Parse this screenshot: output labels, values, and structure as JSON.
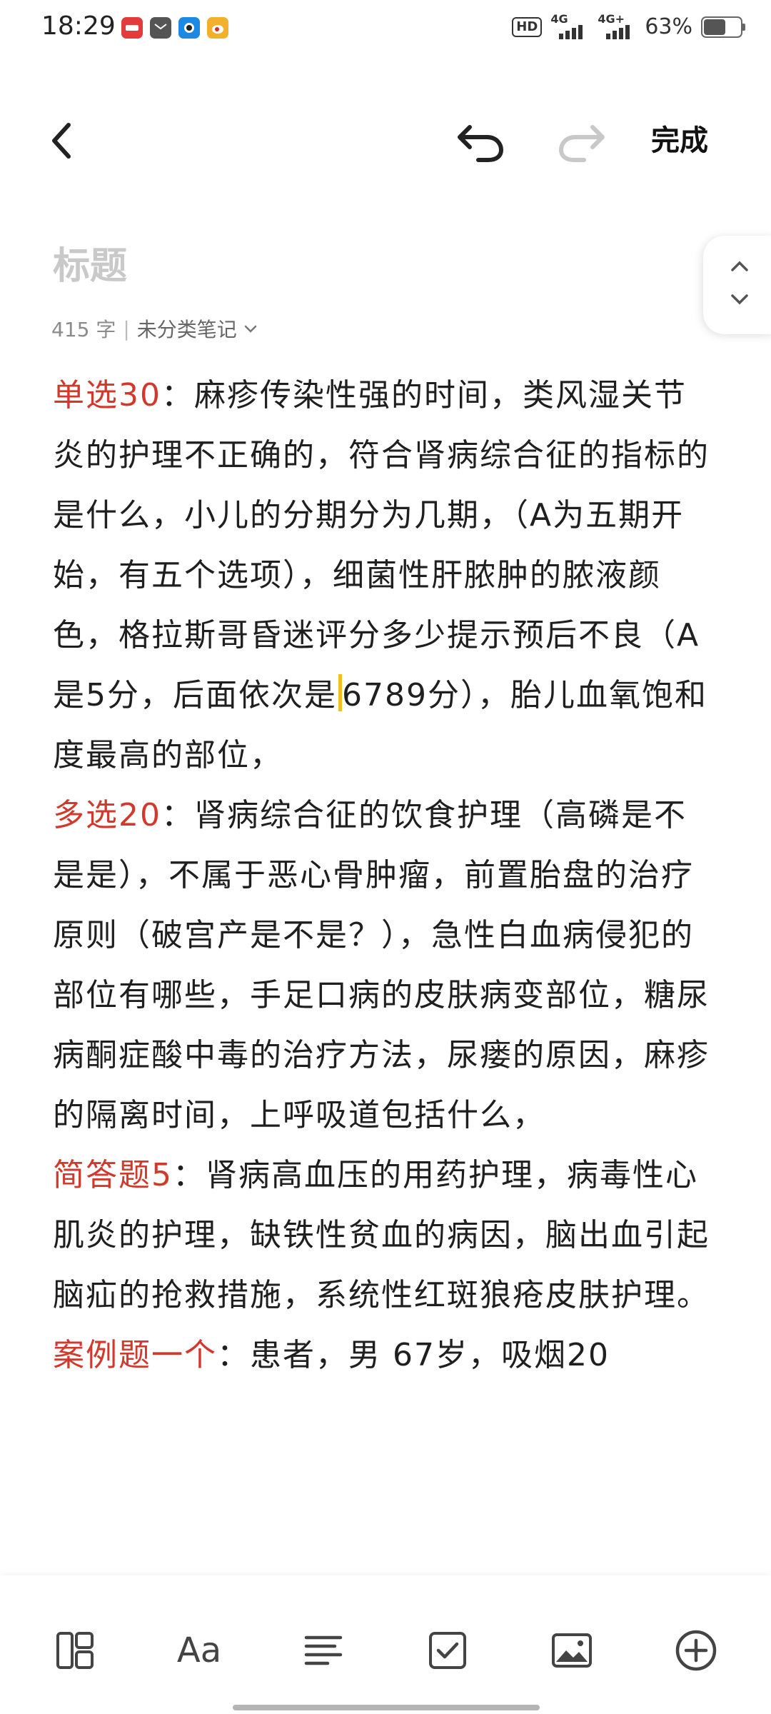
{
  "status_bar": {
    "time": "18:29",
    "hd_badge": "HD",
    "signal1_label": "4G",
    "signal2_label": "4G+",
    "battery_text": "63%",
    "battery_level": 0.63
  },
  "toolbar": {
    "done_label": "完成"
  },
  "note": {
    "title_placeholder": "标题",
    "word_count": "415 字",
    "separator": "|",
    "category": "未分类笔记"
  },
  "paragraphs": [
    {
      "label": "单选30",
      "body": "：麻疹传染性强的时间，类风湿关节炎的护理不正确的，符合肾病综合征的指标的是什么，小儿的分期分为几期，（A为五期开始，有五个选项），细菌性肝脓肿的脓液颜色，格拉斯哥昏迷评分多少提示预后不良（A是5分，后面依次是",
      "tail": "6789分），胎儿血氧饱和度最高的部位，"
    },
    {
      "label": "多选20",
      "body": "：肾病综合征的饮食护理（高磷是不是是），不属于恶心骨肿瘤，前置胎盘的治疗原则（破宫产是不是？），急性白血病侵犯的部位有哪些，手足口病的皮肤病变部位，糖尿病酮症酸中毒的治疗方法，尿瘘的原因，麻疹的隔离时间，上呼吸道包括什么，",
      "tail": ""
    },
    {
      "label": "简答题5",
      "body": "：肾病高血压的用药护理，病毒性心肌炎的护理，缺铁性贫血的病因，脑出血引起脑疝的抢救措施，系统性红斑狼疮皮肤护理。",
      "tail": ""
    },
    {
      "label": "案例题一个",
      "body": "：患者，男 67岁，吸烟20",
      "tail": ""
    }
  ],
  "colors": {
    "accent_red": "#d0392b",
    "cursor_yellow": "#f0c020"
  },
  "bottom_icons": [
    "layout-template-icon",
    "font-icon",
    "paragraph-align-icon",
    "checkbox-icon",
    "image-icon",
    "add-circle-icon"
  ],
  "bottom_font_label": "Aa"
}
